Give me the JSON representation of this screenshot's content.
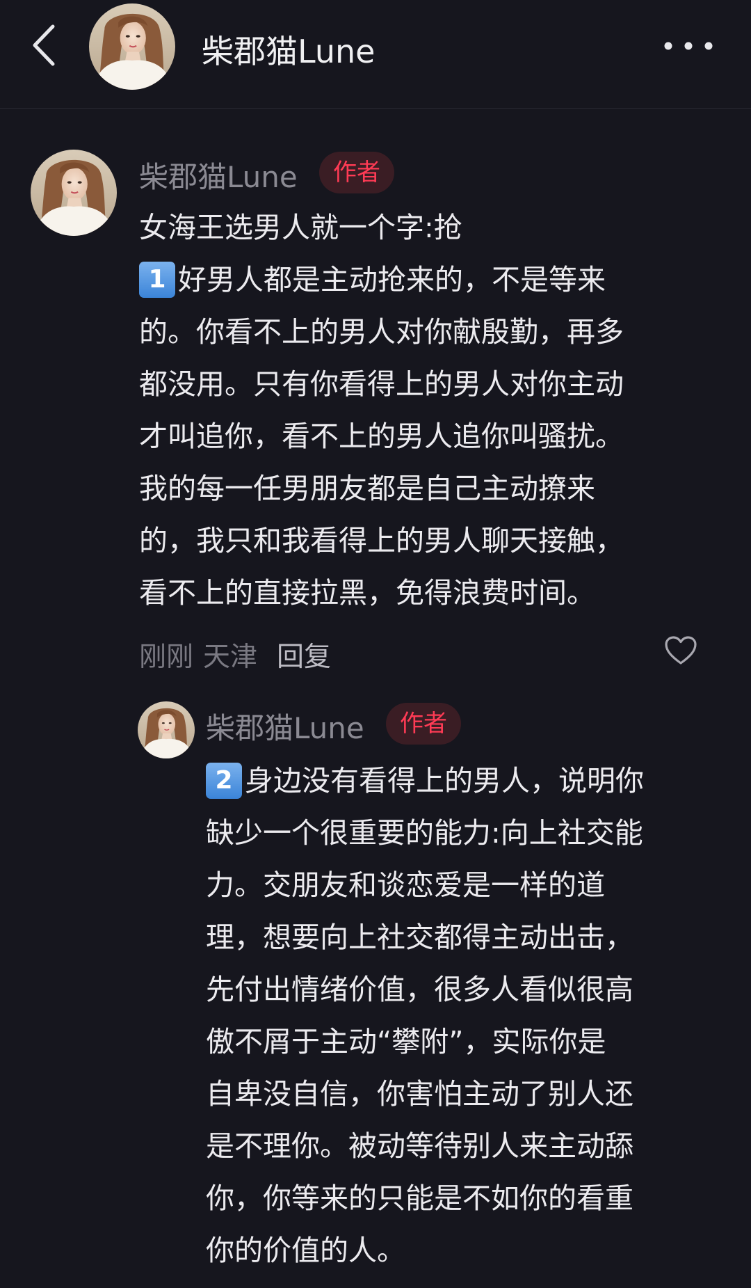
{
  "header": {
    "title": "柴郡猫Lune"
  },
  "comments": [
    {
      "author": "柴郡猫Lune",
      "badge": "作者",
      "lines": [
        "女海王选男人就一个字:抢",
        "好男人都是主动抢来的，不是等来",
        "的。你看不上的男人对你献殷勤，再多",
        "都没用。只有你看得上的男人对你主动",
        "才叫追你，看不上的男人追你叫骚扰。",
        "我的每一任男朋友都是自己主动撩来",
        "的，我只和我看得上的男人聊天接触，",
        "看不上的直接拉黑，免得浪费时间。"
      ],
      "number_badge": "1",
      "time": "刚刚",
      "location": "天津",
      "reply_label": "回复"
    },
    {
      "author": "柴郡猫Lune",
      "badge": "作者",
      "number_badge": "2",
      "lines": [
        "身边没有看得上的男人，说明你",
        "缺少一个很重要的能力:向上社交能",
        "力。交朋友和谈恋爱是一样的道",
        "理，想要向上社交都得主动出击，",
        "先付出情绪价值，很多人看似很高",
        "傲不屑于主动“攀附”，实际你是",
        "自卑没自信，你害怕主动了别人还",
        "是不理你。被动等待别人来主动舔",
        "你，你等来的只能是不如你的看重",
        "你的价值的人。"
      ]
    }
  ],
  "colors": {
    "background": "#16161e",
    "badge_text": "#ff3b55",
    "badge_bg": "#3a1d24",
    "number_badge": "#4a90e2"
  }
}
